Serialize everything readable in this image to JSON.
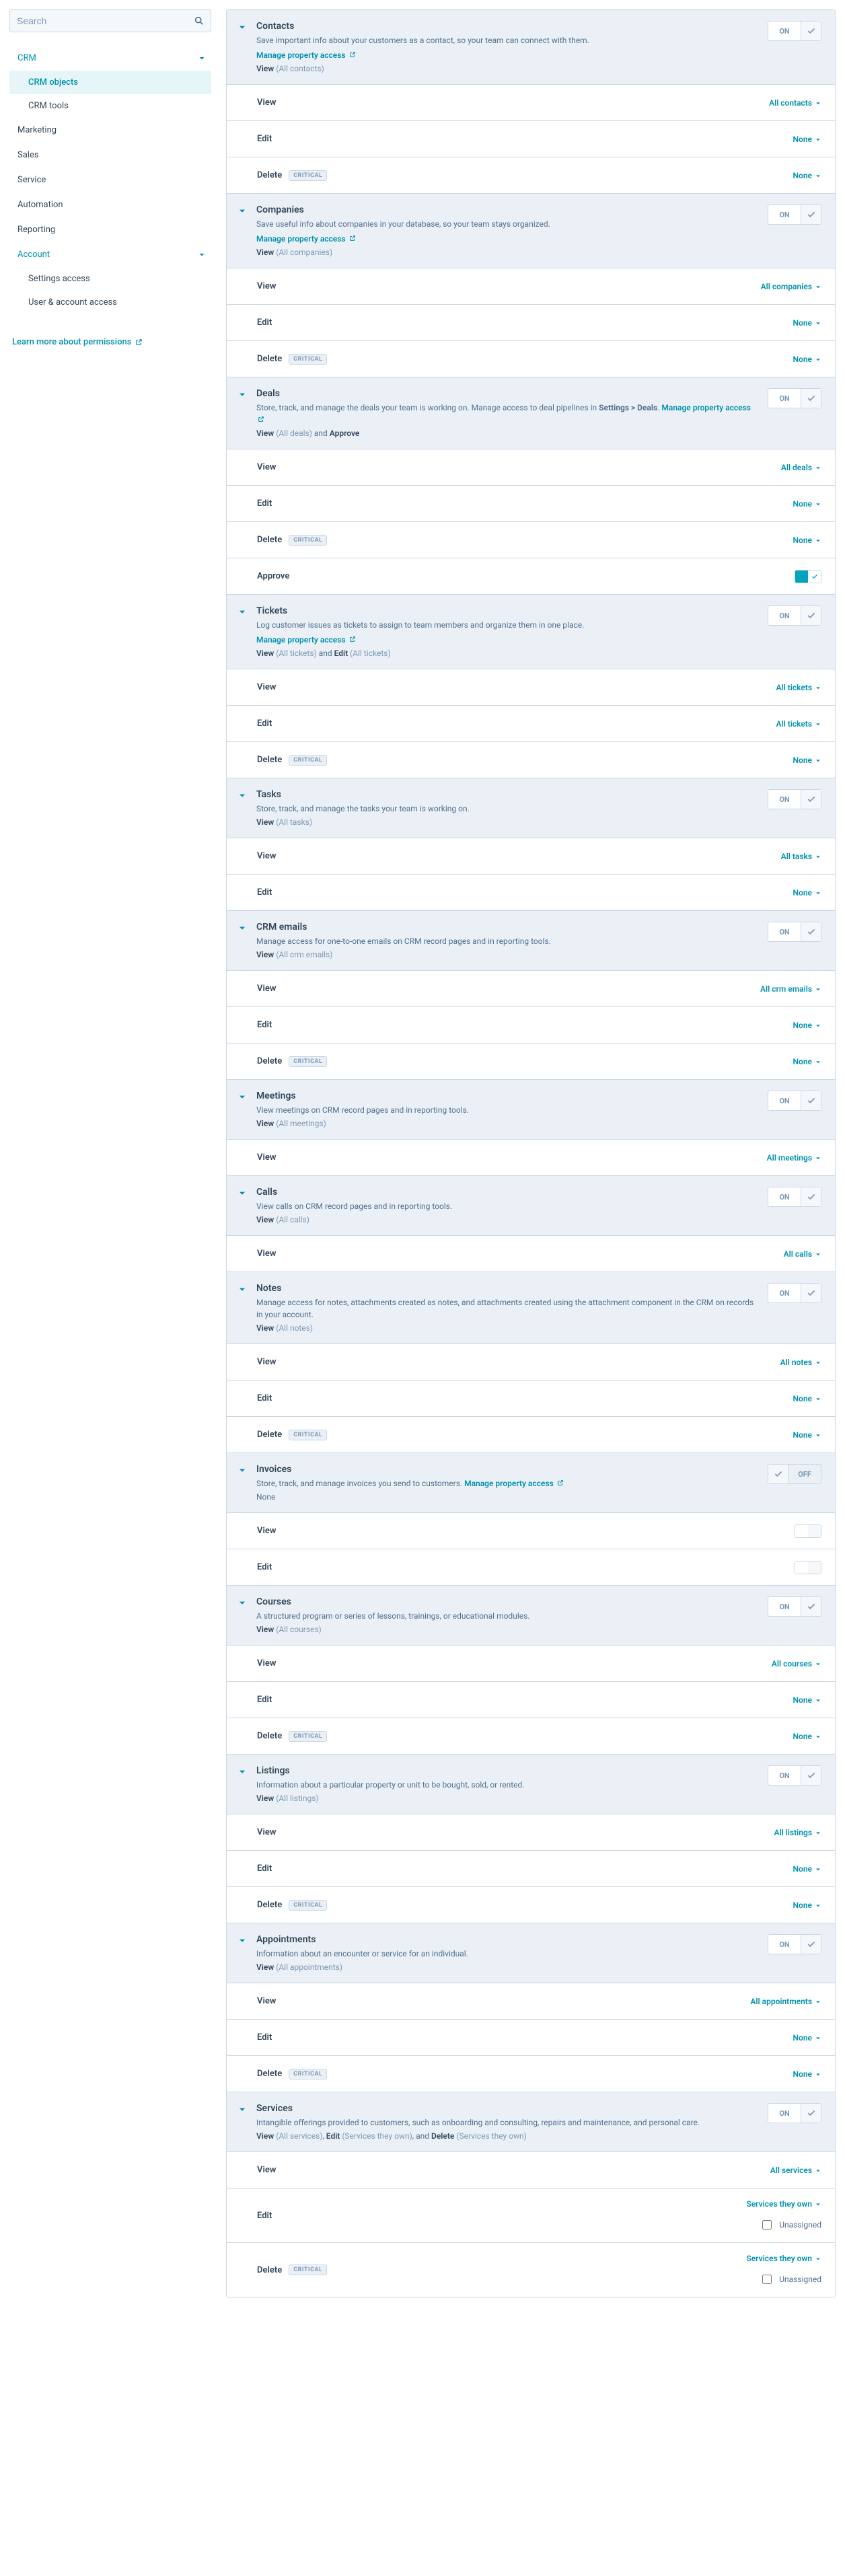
{
  "sidebar": {
    "search_placeholder": "Search",
    "items": [
      {
        "label": "CRM",
        "expanded": true,
        "children": [
          {
            "label": "CRM objects",
            "active": true
          },
          {
            "label": "CRM tools"
          }
        ]
      },
      {
        "label": "Marketing"
      },
      {
        "label": "Sales"
      },
      {
        "label": "Service"
      },
      {
        "label": "Automation"
      },
      {
        "label": "Reporting"
      },
      {
        "label": "Account",
        "expanded": true,
        "children": [
          {
            "label": "Settings access"
          },
          {
            "label": "User & account access"
          }
        ]
      }
    ],
    "learn_more": "Learn more about permissions"
  },
  "strings": {
    "manage_access": "Manage property access",
    "critical": "CRITICAL",
    "on": "ON",
    "off": "OFF",
    "unassigned": "Unassigned",
    "view": "View",
    "edit": "Edit",
    "delete": "Delete",
    "approve": "Approve",
    "none": "None"
  },
  "panels": [
    {
      "id": "contacts",
      "title": "Contacts",
      "desc": "Save important info about your customers as a contact, so your team can connect with them.",
      "manage": true,
      "switch": "on",
      "summary": [
        {
          "b": "View",
          "p": "(All contacts)"
        }
      ],
      "rows": [
        {
          "name": "View",
          "value": "All contacts",
          "dd": true
        },
        {
          "name": "Edit",
          "value": "None",
          "dd": true
        },
        {
          "name": "Delete",
          "badge": "CRITICAL",
          "value": "None",
          "dd": true
        }
      ]
    },
    {
      "id": "companies",
      "title": "Companies",
      "desc": "Save useful info about companies in your database, so your team stays organized.",
      "manage": true,
      "switch": "on",
      "summary": [
        {
          "b": "View",
          "p": "(All companies)"
        }
      ],
      "rows": [
        {
          "name": "View",
          "value": "All companies",
          "dd": true
        },
        {
          "name": "Edit",
          "value": "None",
          "dd": true
        },
        {
          "name": "Delete",
          "badge": "CRITICAL",
          "value": "None",
          "dd": true
        }
      ]
    },
    {
      "id": "deals",
      "title": "Deals",
      "desc_html": "Store, track, and manage the deals your team is working on. Manage access to deal pipelines in <strong>Settings > Deals</strong>. ",
      "manage": true,
      "manage_inline": true,
      "switch": "on",
      "summary": [
        {
          "b": "View",
          "p": "(All deals)"
        },
        {
          "t": " and "
        },
        {
          "b": "Approve"
        }
      ],
      "rows": [
        {
          "name": "View",
          "value": "All deals",
          "dd": true
        },
        {
          "name": "Edit",
          "value": "None",
          "dd": true
        },
        {
          "name": "Delete",
          "badge": "CRITICAL",
          "value": "None",
          "dd": true
        },
        {
          "name": "Approve",
          "mini": "on"
        }
      ]
    },
    {
      "id": "tickets",
      "title": "Tickets",
      "desc": "Log customer issues as tickets to assign to team members and organize them in one place.",
      "manage": true,
      "switch": "on",
      "summary": [
        {
          "b": "View",
          "p": "(All tickets)"
        },
        {
          "t": " and "
        },
        {
          "b": "Edit",
          "p": "(All tickets)"
        }
      ],
      "rows": [
        {
          "name": "View",
          "value": "All tickets",
          "dd": true
        },
        {
          "name": "Edit",
          "value": "All tickets",
          "dd": true
        },
        {
          "name": "Delete",
          "badge": "CRITICAL",
          "value": "None",
          "dd": true
        }
      ]
    },
    {
      "id": "tasks",
      "title": "Tasks",
      "desc": "Store, track, and manage the tasks your team is working on.",
      "switch": "on",
      "summary": [
        {
          "b": "View",
          "p": "(All tasks)"
        }
      ],
      "rows": [
        {
          "name": "View",
          "value": "All tasks",
          "dd": true
        },
        {
          "name": "Edit",
          "value": "None",
          "dd": true
        }
      ]
    },
    {
      "id": "crmemails",
      "title": "CRM emails",
      "desc": "Manage access for one-to-one emails on CRM record pages and in reporting tools.",
      "switch": "on",
      "summary": [
        {
          "b": "View",
          "p": "(All crm emails)"
        }
      ],
      "rows": [
        {
          "name": "View",
          "value": "All crm emails",
          "dd": true
        },
        {
          "name": "Edit",
          "value": "None",
          "dd": true
        },
        {
          "name": "Delete",
          "badge": "CRITICAL",
          "value": "None",
          "dd": true
        }
      ]
    },
    {
      "id": "meetings",
      "title": "Meetings",
      "desc": "View meetings on CRM record pages and in reporting tools.",
      "switch": "on",
      "summary": [
        {
          "b": "View",
          "p": "(All meetings)"
        }
      ],
      "rows": [
        {
          "name": "View",
          "value": "All meetings",
          "dd": true
        }
      ]
    },
    {
      "id": "calls",
      "title": "Calls",
      "desc": "View calls on CRM record pages and in reporting tools.",
      "switch": "on",
      "summary": [
        {
          "b": "View",
          "p": "(All calls)"
        }
      ],
      "rows": [
        {
          "name": "View",
          "value": "All calls",
          "dd": true
        }
      ]
    },
    {
      "id": "notes",
      "title": "Notes",
      "desc": "Manage access for notes, attachments created as notes, and attachments created using the attachment component in the CRM on records in your account.",
      "switch": "on",
      "summary": [
        {
          "b": "View",
          "p": "(All notes)"
        }
      ],
      "rows": [
        {
          "name": "View",
          "value": "All notes",
          "dd": true
        },
        {
          "name": "Edit",
          "value": "None",
          "dd": true
        },
        {
          "name": "Delete",
          "badge": "CRITICAL",
          "value": "None",
          "dd": true
        }
      ]
    },
    {
      "id": "invoices",
      "title": "Invoices",
      "desc_html": "Store, track, and manage invoices you send to customers. ",
      "manage": true,
      "manage_inline": true,
      "switch": "off",
      "summary": [
        {
          "t": "None"
        }
      ],
      "rows": [
        {
          "name": "View",
          "mini": "off"
        },
        {
          "name": "Edit",
          "mini": "off"
        }
      ]
    },
    {
      "id": "courses",
      "title": "Courses",
      "desc": "A structured program or series of lessons, trainings, or educational modules.",
      "switch": "on",
      "summary": [
        {
          "b": "View",
          "p": "(All courses)"
        }
      ],
      "rows": [
        {
          "name": "View",
          "value": "All courses",
          "dd": true
        },
        {
          "name": "Edit",
          "value": "None",
          "dd": true
        },
        {
          "name": "Delete",
          "badge": "CRITICAL",
          "value": "None",
          "dd": true
        }
      ]
    },
    {
      "id": "listings",
      "title": "Listings",
      "desc": "Information about a particular property or unit to be bought, sold, or rented.",
      "switch": "on",
      "summary": [
        {
          "b": "View",
          "p": "(All listings)"
        }
      ],
      "rows": [
        {
          "name": "View",
          "value": "All listings",
          "dd": true
        },
        {
          "name": "Edit",
          "value": "None",
          "dd": true
        },
        {
          "name": "Delete",
          "badge": "CRITICAL",
          "value": "None",
          "dd": true
        }
      ]
    },
    {
      "id": "appointments",
      "title": "Appointments",
      "desc": "Information about an encounter or service for an individual.",
      "switch": "on",
      "summary": [
        {
          "b": "View",
          "p": "(All appointments)"
        }
      ],
      "rows": [
        {
          "name": "View",
          "value": "All appointments",
          "dd": true
        },
        {
          "name": "Edit",
          "value": "None",
          "dd": true
        },
        {
          "name": "Delete",
          "badge": "CRITICAL",
          "value": "None",
          "dd": true
        }
      ]
    },
    {
      "id": "services",
      "title": "Services",
      "desc": "Intangible offerings provided to customers, such as onboarding and consulting, repairs and maintenance, and personal care.",
      "switch": "on",
      "summary": [
        {
          "b": "View",
          "p": "(All services)"
        },
        {
          "t": ", "
        },
        {
          "b": "Edit",
          "p": "(Services they own)"
        },
        {
          "t": ", and "
        },
        {
          "b": "Delete",
          "p": "(Services they own)"
        }
      ],
      "rows": [
        {
          "name": "View",
          "value": "All services",
          "dd": true
        },
        {
          "name": "Edit",
          "value": "Services they own",
          "dd": true,
          "unassigned": true
        },
        {
          "name": "Delete",
          "badge": "CRITICAL",
          "value": "Services they own",
          "dd": true,
          "unassigned": true
        }
      ]
    }
  ]
}
